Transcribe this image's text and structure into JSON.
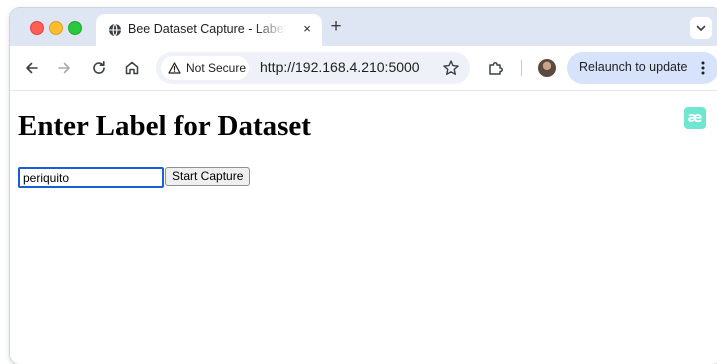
{
  "browser": {
    "tab": {
      "title": "Bee Dataset Capture - Label Input",
      "close_glyph": "×",
      "favicon": "globe-icon"
    },
    "new_tab_glyph": "+",
    "toolbar": {
      "security_label": "Not Secure",
      "url": "http://192.168.4.210:5000",
      "relaunch_label": "Relaunch to update",
      "icons": [
        "back-arrow-icon",
        "forward-arrow-icon",
        "reload-icon",
        "home-icon",
        "warning-triangle-icon",
        "star-icon",
        "extensions-puzzle-icon",
        "avatar",
        "kebab-menu-icon"
      ]
    }
  },
  "page": {
    "heading": "Enter Label for Dataset",
    "label_input": {
      "value": "periquito"
    },
    "start_button_label": "Start Capture",
    "extension_badge": "æ"
  },
  "colors": {
    "tabstrip_bg": "#dfe6f3",
    "relaunch_bg": "#d7e3fb",
    "input_focus_border": "#1a5dd8",
    "extension_badge_bg": "#6ee6d0"
  }
}
